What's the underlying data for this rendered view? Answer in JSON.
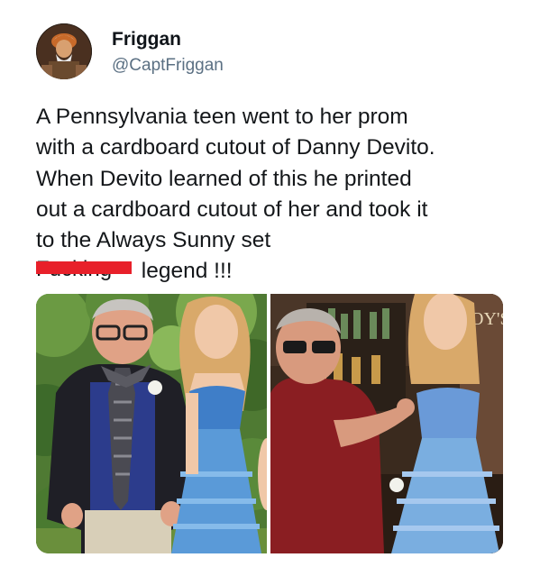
{
  "author": {
    "display_name": "Friggan",
    "handle": "@CaptFriggan"
  },
  "tweet": {
    "lines": [
      "A Pennsylvania teen went to her prom",
      "with a cardboard cutout of Danny Devito.",
      "When Devito learned of this he printed",
      "out a cardboard cutout of her and took it",
      "to the Always Sunny set"
    ],
    "last_line": {
      "redacted_word": "Fucking",
      "rest": " legend !!!"
    }
  },
  "media": {
    "count": 2,
    "photos": [
      {
        "subject": "prom-couple-garden"
      },
      {
        "subject": "bar-set-with-cutout",
        "sign_text": "OY'S"
      }
    ]
  },
  "colors": {
    "text": "#14171a",
    "handle": "#5b7083",
    "redaction": "#e8202a"
  }
}
